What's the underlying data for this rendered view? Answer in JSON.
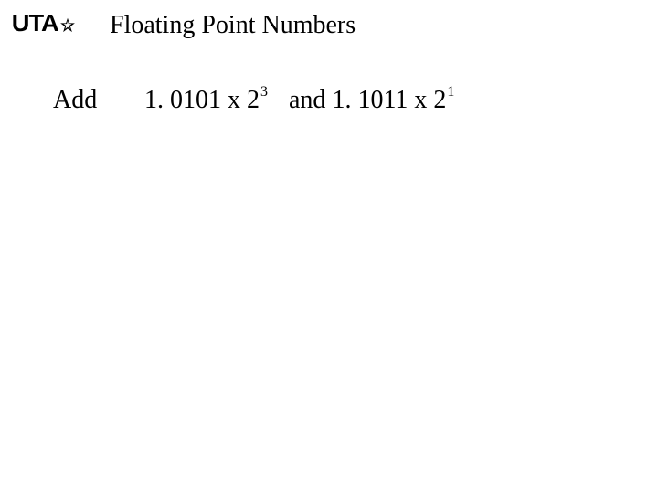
{
  "logo": {
    "text": "UTA"
  },
  "title": "Floating Point Numbers",
  "problem": {
    "label": "Add",
    "term1": {
      "mantissa": "1. 0101",
      "times": " x ",
      "base": "2",
      "exponent": "3"
    },
    "conjunction": "  and ",
    "term2": {
      "mantissa": "1. 1011",
      "times": " x ",
      "base": "2",
      "exponent": "1"
    }
  }
}
